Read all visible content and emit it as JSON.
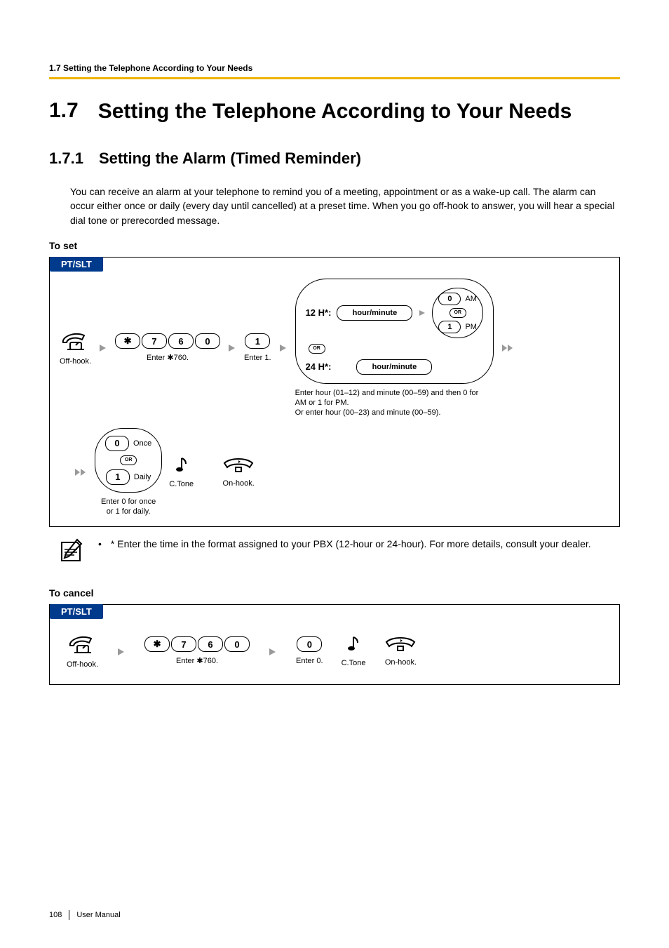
{
  "running_head": "1.7 Setting the Telephone According to Your Needs",
  "h1": {
    "num": "1.7",
    "title": "Setting the Telephone According to Your Needs"
  },
  "h2": {
    "num": "1.7.1",
    "title": "Setting the Alarm (Timed Reminder)"
  },
  "intro": "You can receive an alarm at your telephone to remind you of a meeting, appointment or as a wake-up call. The alarm can occur either once or daily (every day until cancelled) at a preset time. When you go off-hook to answer, you will hear a special dial tone or prerecorded message.",
  "to_set_label": "To set",
  "to_cancel_label": "To cancel",
  "pill": "PT/SLT",
  "keys": {
    "star": "✱",
    "k7": "7",
    "k6": "6",
    "k0": "0",
    "k1": "1"
  },
  "steps": {
    "offhook": "Off-hook.",
    "enter760": "Enter ✱760.",
    "enter1": "Enter 1.",
    "enter0": "Enter 0.",
    "ctone": "C.Tone",
    "onhook": "On-hook.",
    "once": "Once",
    "daily": "Daily",
    "once_daily_caption": "Enter 0 for once\nor 1 for daily.",
    "or": "OR",
    "am": "AM",
    "pm": "PM",
    "h12": "12 H*:",
    "h24": "24 H*:",
    "hourminute": "hour/minute",
    "time_caption_line1": "Enter hour (01–12) and minute (00–59) and then 0 for AM or 1 for PM.",
    "time_caption_line2": "Or enter hour (00–23) and minute (00–59)."
  },
  "note": "* Enter the time in the format assigned to your PBX (12-hour or 24-hour). For more details, consult your dealer.",
  "footer": {
    "page": "108",
    "label": "User Manual"
  }
}
